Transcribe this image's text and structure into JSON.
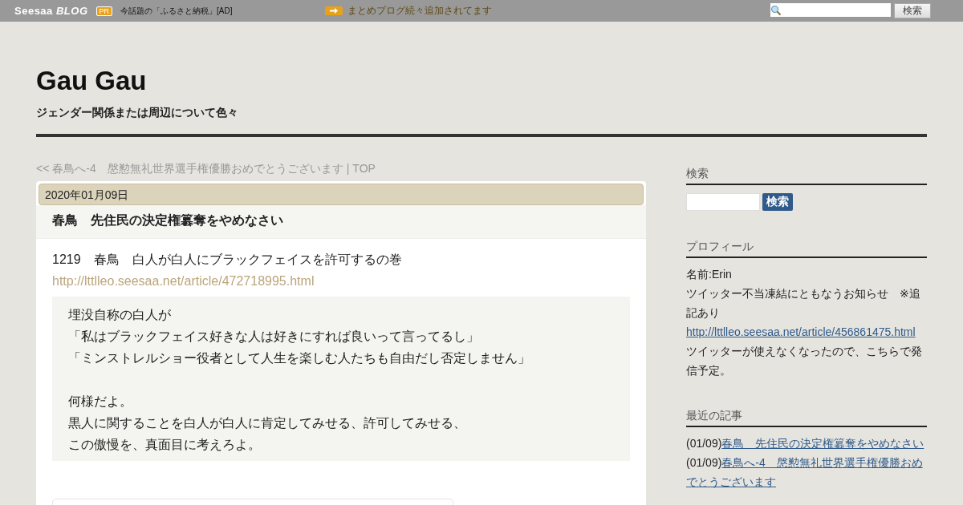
{
  "topbar": {
    "logo": "Seesaa",
    "logo_sub": "BLOG",
    "pr_badge": "PR",
    "pr_text": "今話題の「ふるさと納税」[AD]",
    "notice": "まとめブログ続々追加されてます",
    "search_button": "検索"
  },
  "header": {
    "title": "Gau Gau",
    "subtitle": "ジェンダー関係または周辺について色々"
  },
  "nav": {
    "prev": "<< 春鳥へ-4　慇懃無礼世界選手権優勝おめでとうございます",
    "separator": "|",
    "top": "TOP"
  },
  "article": {
    "date": "2020年01月09日",
    "title": "春鳥　先住民の決定権簒奪をやめなさい",
    "intro": "1219　春鳥　白人が白人にブラックフェイスを許可するの巻",
    "link": "http://lttlleo.seesaa.net/article/472718995.html",
    "quote": [
      [
        "埋没自称の白人が",
        "「私はブラックフェイス好きな人は好きにすれば良いって言ってるし」",
        "「ミンストレルショー役者として人生を楽しむ人たちも自由だし否定しません」"
      ],
      [
        "何様だよ。",
        "黒人に関することを白人が白人に肯定してみせる、許可してみせる、",
        "この傲慢を、真面目に考えろよ。"
      ]
    ]
  },
  "sidebar": {
    "search": {
      "heading": "検索",
      "button": "検索"
    },
    "profile": {
      "heading": "プロフィール",
      "name": "名前:Erin",
      "notice": "ツイッター不当凍結にともなうお知らせ　※追記あり",
      "link": "http://lttlleo.seesaa.net/article/456861475.html",
      "note": "ツイッターが使えなくなったので、こちらで発信予定。"
    },
    "recent": {
      "heading": "最近の記事",
      "items": [
        {
          "date": "(01/09)",
          "title": "春鳥　先住民の決定権簒奪をやめなさい"
        },
        {
          "date": "(01/09)",
          "title": "春鳥へ-4　慇懃無礼世界選手権優勝おめでとうございます"
        }
      ]
    }
  }
}
